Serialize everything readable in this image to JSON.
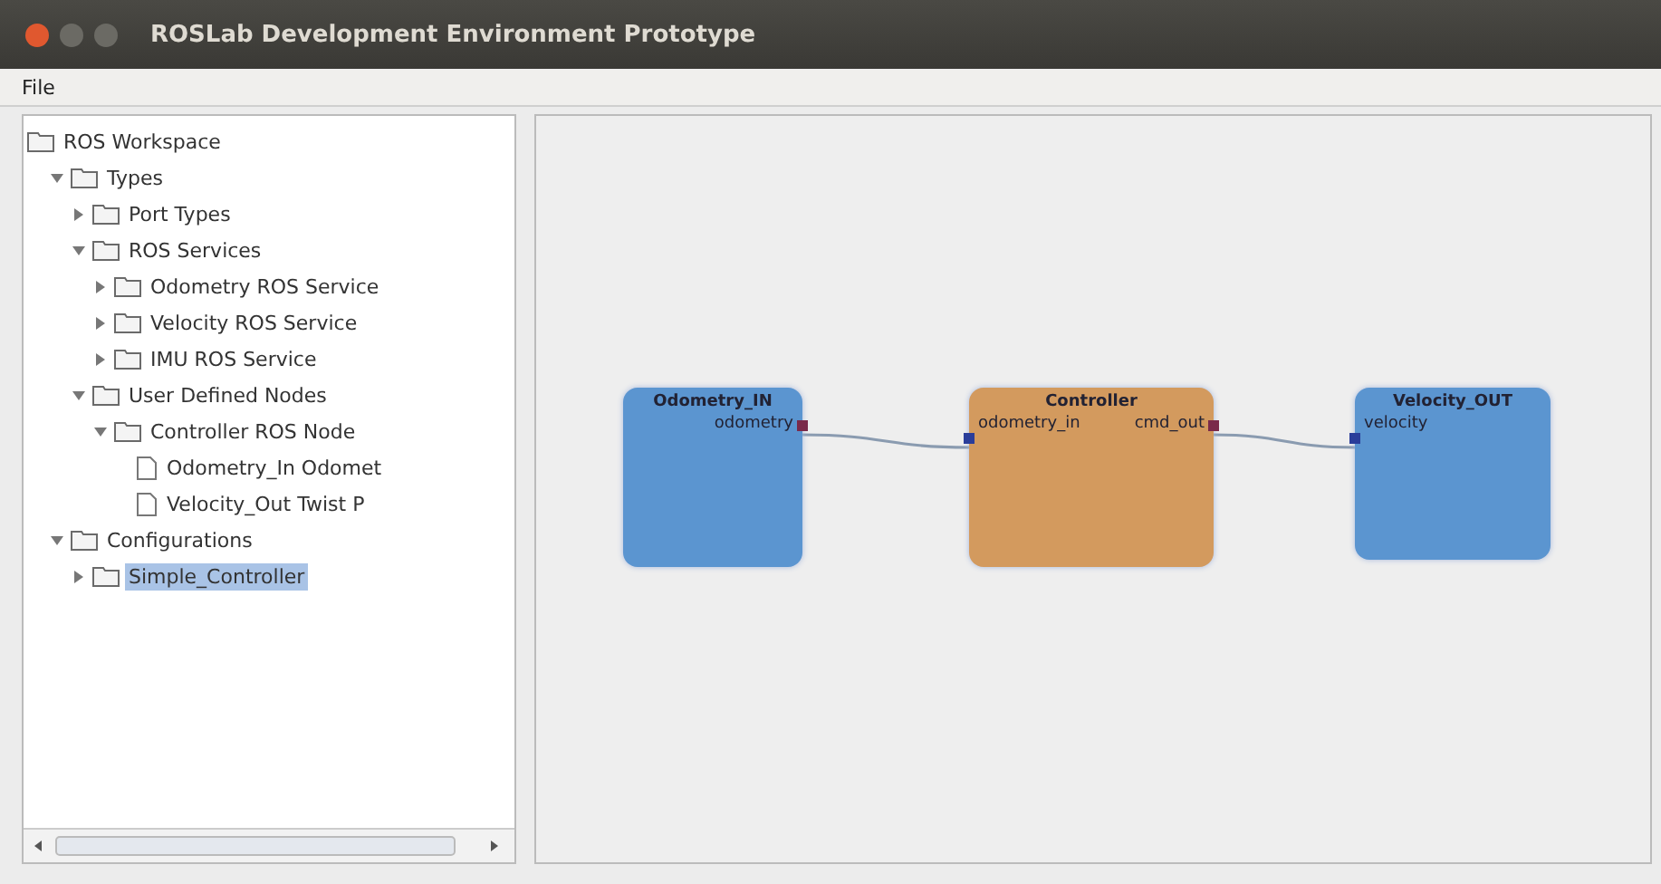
{
  "window": {
    "title": "ROSLab Development Environment Prototype"
  },
  "menu": [
    "File"
  ],
  "tree": {
    "label": "ROS Workspace",
    "children": [
      {
        "label": "Types",
        "expanded": true,
        "selected": false,
        "children": [
          {
            "label": "Port Types",
            "expanded": false,
            "selected": false
          },
          {
            "label": "ROS Services",
            "expanded": true,
            "selected": false,
            "children": [
              {
                "label": "Odometry ROS Service",
                "expanded": false,
                "selected": false
              },
              {
                "label": "Velocity ROS Service",
                "expanded": false,
                "selected": false
              },
              {
                "label": "IMU ROS Service",
                "expanded": false,
                "selected": false
              }
            ]
          },
          {
            "label": "User Defined Nodes",
            "expanded": true,
            "selected": false,
            "children": [
              {
                "label": "Controller ROS Node",
                "expanded": true,
                "selected": false,
                "children": [
                  {
                    "kind": "leaf",
                    "label": "Odometry_In Odomet",
                    "selected": false
                  },
                  {
                    "kind": "leaf",
                    "label": "Velocity_Out Twist P",
                    "selected": false
                  }
                ]
              }
            ]
          }
        ]
      },
      {
        "label": "Configurations",
        "expanded": true,
        "selected": false,
        "children": [
          {
            "label": "Simple_Controller",
            "expanded": false,
            "selected": true
          }
        ]
      }
    ]
  },
  "nodes": [
    {
      "kind": "source",
      "title": "Odometry_IN",
      "ports": [
        {
          "kind": "output",
          "label": "odometry"
        }
      ]
    },
    {
      "kind": "controller",
      "title": "Controller",
      "ports": [
        {
          "kind": "input",
          "label": "odometry_in"
        },
        {
          "kind": "output",
          "label": "cmd_out"
        }
      ]
    },
    {
      "kind": "sink",
      "title": "Velocity_OUT",
      "ports": [
        {
          "kind": "input",
          "label": "velocity"
        }
      ]
    }
  ]
}
